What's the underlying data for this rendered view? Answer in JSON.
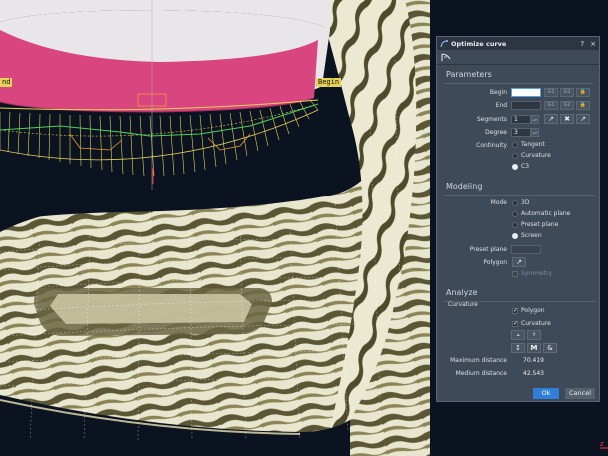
{
  "viewport": {
    "label_left": "nd",
    "label_right": "Begin",
    "corner_label": "z"
  },
  "dialog": {
    "title": "Optimize curve",
    "help_label": "?",
    "close_label": "×",
    "parameters": {
      "heading": "Parameters",
      "begin_label": "Begin",
      "begin_value": "",
      "end_label": "End",
      "end_value": "",
      "g1_label": "G1",
      "g2_label": "G2",
      "segments_label": "Segments",
      "segments_value": "1",
      "degree_label": "Degree",
      "degree_value": "3",
      "continuity_label": "Continuity",
      "continuity_options": [
        "Tangent",
        "Curvature",
        "C3"
      ],
      "continuity_selected": "C3"
    },
    "modeling": {
      "heading": "Modeling",
      "mode_label": "Mode",
      "mode_options": [
        "3D",
        "Automatic plane",
        "Preset plane",
        "Screen"
      ],
      "mode_selected": "Screen",
      "preset_plane_label": "Preset plane",
      "preset_plane_value": "",
      "polygon_label": "Polygon",
      "symmetry_label": "Symmetry"
    },
    "analyze": {
      "heading": "Analyze",
      "curvature_label": "Curvature",
      "polygon_check_label": "Polygon",
      "curvature_check_label": "Curvature",
      "m_label": "M",
      "max_distance_label": "Maximum distance",
      "max_distance_value": "70.419",
      "medium_distance_label": "Medium distance",
      "medium_distance_value": "42.543"
    },
    "ok_label": "Ok",
    "cancel_label": "Cancel"
  },
  "colors": {
    "background": "#0b1320",
    "panel": "#3f4a58",
    "accent": "#2f7fd8",
    "surface_pink": "#d8457f",
    "curve_yellow": "#e8d25a",
    "curve_green": "#4cd05a"
  }
}
